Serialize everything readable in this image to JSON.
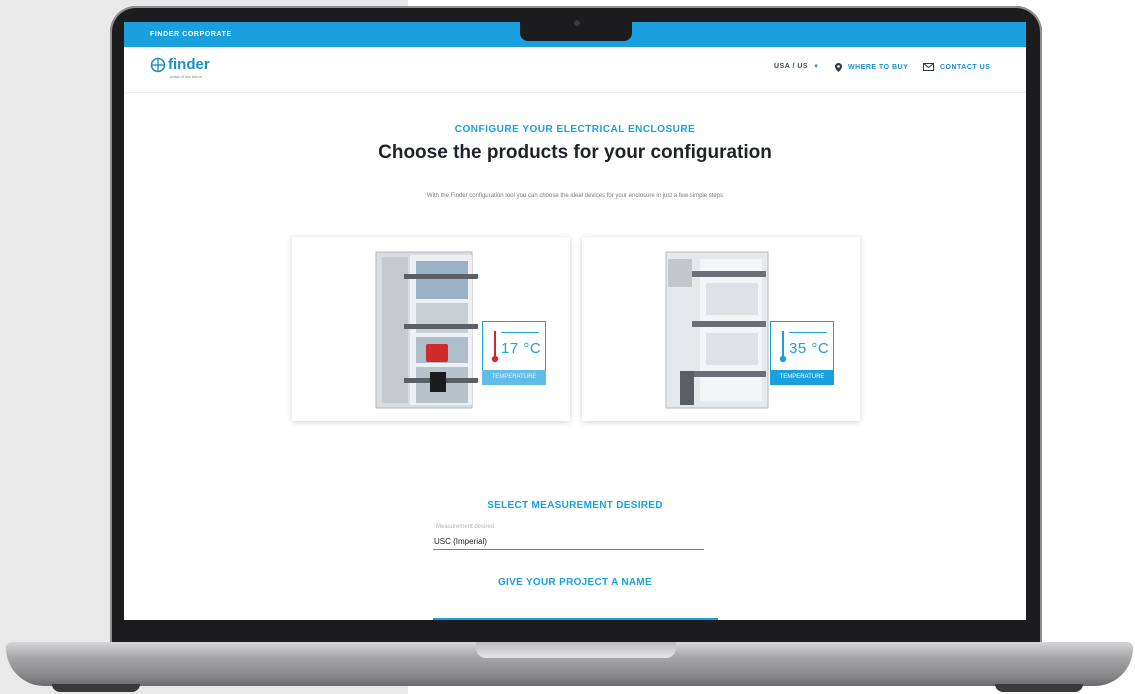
{
  "topbar": {
    "label": "FINDER CORPORATE"
  },
  "header": {
    "logo": {
      "word": "finder",
      "tagline": "pulse of the future"
    },
    "region": "USA / US",
    "where_to_buy": "WHERE TO BUY",
    "contact": "CONTACT US"
  },
  "hero": {
    "kicker": "CONFIGURE YOUR ELECTRICAL ENCLOSURE",
    "title": "Choose the products for your configuration",
    "subtitle": "With the Finder configuration tool you can choose the ideal devices for your enclosure in just a few simple steps"
  },
  "cards": [
    {
      "temperature": "17 °C",
      "label": "TEMPERATURE"
    },
    {
      "temperature": "35 °C",
      "label": "TEMPERATURE"
    }
  ],
  "measurement": {
    "heading": "SELECT MEASUREMENT DESIRED",
    "field_label": "Measurement desired",
    "value": "USC (Imperial)"
  },
  "project": {
    "heading": "GIVE YOUR PROJECT A NAME"
  },
  "colors": {
    "accent": "#1aa0dc",
    "title": "#1f2329"
  },
  "icons": [
    "location-pin-icon",
    "mail-icon",
    "chevron-down-icon",
    "thermometer-icon",
    "finder-logo-icon"
  ]
}
